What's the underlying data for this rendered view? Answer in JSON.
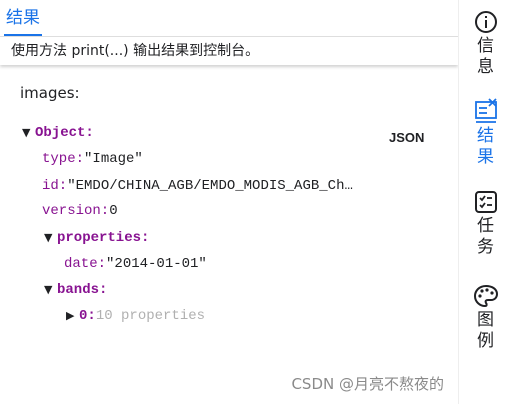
{
  "tabs": {
    "active": "结果"
  },
  "hint": "使用方法 print(...) 输出结果到控制台。",
  "output": {
    "label": "images:",
    "view_mode": "JSON",
    "tree": {
      "root_key": "Object:",
      "type_key": "type:",
      "type_val": "\"Image\"",
      "id_key": "id:",
      "id_val": "\"EMDO/CHINA_AGB/EMDO_MODIS_AGB_Ch…",
      "version_key": "version:",
      "version_val": "0",
      "properties_key": "properties:",
      "date_key": "date:",
      "date_val": "\"2014-01-01\"",
      "bands_key": "bands:",
      "band0_key": "0:",
      "band0_summary": "10 properties"
    }
  },
  "sidebar": {
    "items": [
      {
        "label": "信息",
        "icon": "info-icon"
      },
      {
        "label": "结果",
        "icon": "result-icon",
        "active": true
      },
      {
        "label": "任务",
        "icon": "task-list-icon"
      },
      {
        "label": "图例",
        "icon": "palette-icon"
      }
    ]
  },
  "colors": {
    "accent": "#1a73e8",
    "key": "#881391",
    "string": "#c41a16",
    "number": "#1c00cf"
  },
  "watermark": "CSDN @月亮不熬夜的"
}
